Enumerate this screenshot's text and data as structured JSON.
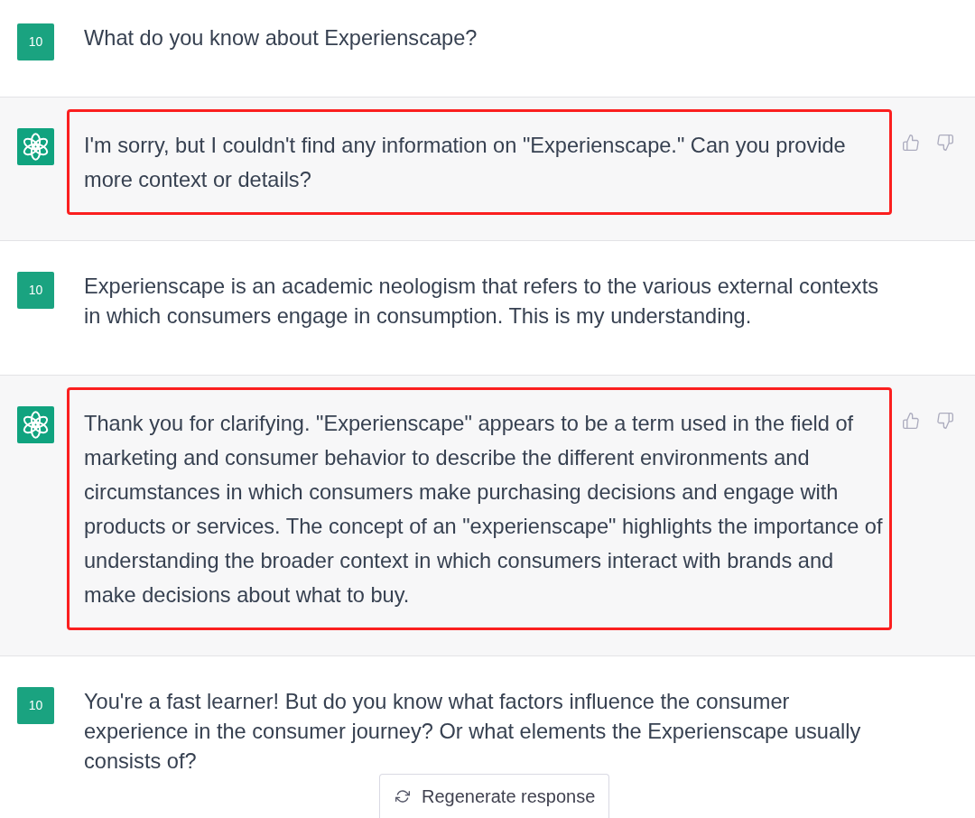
{
  "messages": [
    {
      "kind": "user",
      "avatar": "10",
      "text": "What do you know about Experienscape?",
      "highlighted": false
    },
    {
      "kind": "assistant",
      "text": "I'm sorry, but I couldn't find any information on \"Experienscape.\" Can you provide more context or details?",
      "highlighted": true
    },
    {
      "kind": "user",
      "avatar": "10",
      "text": "Experienscape is an academic neologism that refers to the various external contexts in which consumers engage in consumption. This is my understanding.",
      "highlighted": false
    },
    {
      "kind": "assistant",
      "text": "Thank you for clarifying. \"Experienscape\" appears to be a term used in the field of marketing and consumer behavior to describe the different environments and circumstances in which consumers make purchasing decisions and engage with products or services. The concept of an \"experienscape\" highlights the importance of understanding the broader context in which consumers interact with brands and make decisions about what to buy.",
      "highlighted": true
    },
    {
      "kind": "user",
      "avatar": "10",
      "text": "You're a fast learner! But do you know what factors influence the consumer experience in the consumer journey? Or what elements the Experienscape usually consists of?",
      "highlighted": false
    }
  ],
  "regenerate_button": {
    "label": "Regenerate response"
  }
}
